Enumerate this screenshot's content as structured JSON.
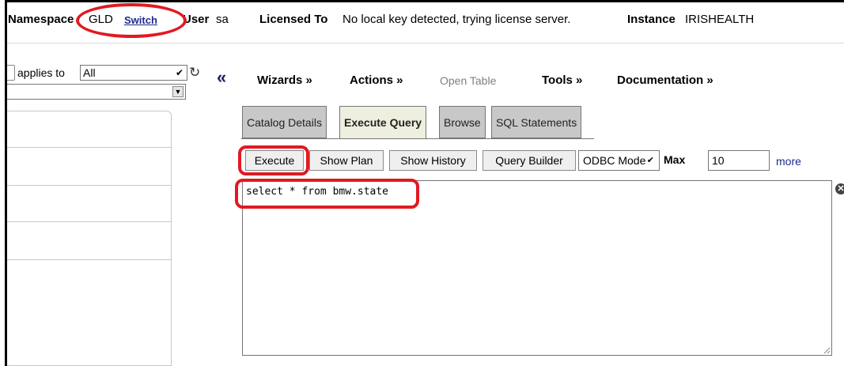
{
  "header": {
    "namespace_label": "Namespace",
    "namespace_value": "GLD",
    "switch_label": "Switch",
    "user_label": "User",
    "user_value": "sa",
    "licensed_label": "Licensed To",
    "licensed_value": "No local key detected, trying license server.",
    "instance_label": "Instance",
    "instance_value": "IRISHEALTH"
  },
  "left_panel": {
    "applies_label": "applies to",
    "applies_value": "All"
  },
  "menu": {
    "wizards": "Wizards »",
    "actions": "Actions »",
    "open_table": "Open Table",
    "tools": "Tools »",
    "documentation": "Documentation »"
  },
  "tabs": [
    "Catalog Details",
    "Execute Query",
    "Browse",
    "SQL Statements"
  ],
  "active_tab": "Execute Query",
  "toolbar": {
    "execute": "Execute",
    "show_plan": "Show Plan",
    "show_history": "Show History",
    "query_builder": "Query Builder",
    "mode_value": "ODBC Mode",
    "max_label": "Max",
    "max_value": "10",
    "more": "more"
  },
  "query": {
    "text": "select * from bmw.state"
  },
  "colors": {
    "annotation": "#e01a22",
    "link": "#1c2a8a",
    "active_tab_bg": "#efefdf",
    "tab_bg": "#c8c8c8"
  },
  "icons": {
    "refresh": "refresh-icon",
    "collapse": "double-chevron-left-icon",
    "clear": "clear-icon"
  }
}
